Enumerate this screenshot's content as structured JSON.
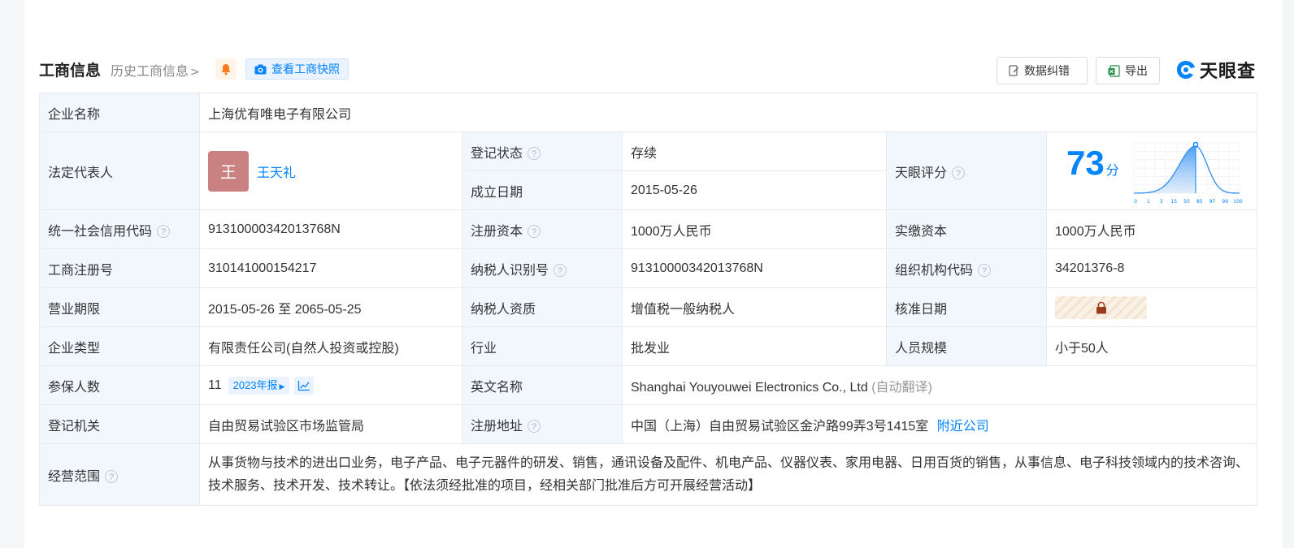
{
  "header": {
    "title": "工商信息",
    "history_link": "历史工商信息",
    "snapshot_button": "查看工商快照",
    "correction_button": "数据纠错",
    "export_button": "导出",
    "logo_text": "天眼查"
  },
  "company": {
    "name_label": "企业名称",
    "name": "上海优有唯电子有限公司",
    "legal_rep_label": "法定代表人",
    "legal_rep_avatar": "王",
    "legal_rep_name": "王天礼",
    "reg_status_label": "登记状态",
    "reg_status": "存续",
    "founded_label": "成立日期",
    "founded": "2015-05-26",
    "rating_label": "天眼评分",
    "score": "73",
    "score_unit": "分",
    "credit_code_label": "统一社会信用代码",
    "credit_code": "91310000342013768N",
    "reg_capital_label": "注册资本",
    "reg_capital": "1000万人民币",
    "paid_capital_label": "实缴资本",
    "paid_capital": "1000万人民币",
    "reg_no_label": "工商注册号",
    "reg_no": "310141000154217",
    "taxpayer_id_label": "纳税人识别号",
    "taxpayer_id": "91310000342013768N",
    "org_code_label": "组织机构代码",
    "org_code": "34201376-8",
    "term_label": "营业期限",
    "term": "2015-05-26 至 2065-05-25",
    "tax_qual_label": "纳税人资质",
    "tax_qual": "增值税一般纳税人",
    "approval_date_label": "核准日期",
    "type_label": "企业类型",
    "type": "有限责任公司(自然人投资或控股)",
    "industry_label": "行业",
    "industry": "批发业",
    "staff_size_label": "人员规模",
    "staff_size": "小于50人",
    "insured_label": "参保人数",
    "insured": "11",
    "insured_year": "2023年报",
    "english_name_label": "英文名称",
    "english_name": "Shanghai Youyouwei Electronics Co., Ltd",
    "english_name_note": "(自动翻译)",
    "authority_label": "登记机关",
    "authority": "自由贸易试验区市场监管局",
    "address_label": "注册地址",
    "address": "中国（上海）自由贸易试验区金沪路99弄3号1415室",
    "nearby_link": "附近公司",
    "scope_label": "经营范围",
    "scope": "从事货物与技术的进出口业务，电子产品、电子元器件的研发、销售，通讯设备及配件、机电产品、仪器仪表、家用电器、日用百货的销售，从事信息、电子科技领域内的技术咨询、技术服务、技术开发、技术转让。【依法须经批准的项目，经相关部门批准后方可开展经营活动】"
  },
  "rating_chart": {
    "x_ticks": [
      "0",
      "1",
      "3",
      "15",
      "50",
      "85",
      "97",
      "99",
      "100"
    ]
  },
  "colors": {
    "accent": "#0084ff",
    "status_green": "#16a34a",
    "label_bg": "#f2f7fe",
    "avatar_bg": "#c98181"
  },
  "icons": [
    "bell-icon",
    "camera-icon",
    "edit-icon",
    "excel-icon",
    "question-icon",
    "lock-icon",
    "trend-icon",
    "logo-icon"
  ]
}
